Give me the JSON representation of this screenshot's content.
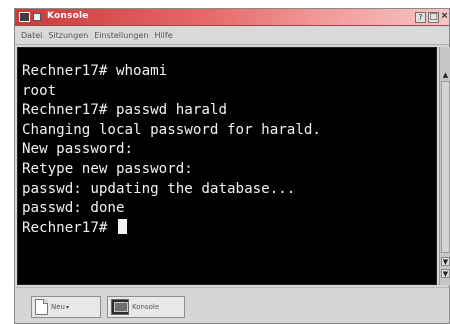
{
  "window": {
    "title": "Konsole",
    "help_label": "?",
    "minimize_label": "□",
    "close_label": "×"
  },
  "menu": {
    "items": [
      "Datei",
      "Sitzungen",
      "Einstellungen",
      "Hilfe"
    ]
  },
  "terminal": {
    "lines": [
      "Rechner17# whoami",
      "root",
      "Rechner17# passwd harald",
      "Changing local password for harald.",
      "New password:",
      "Retype new password:",
      "passwd: updating the database...",
      "passwd: done",
      "Rechner17# "
    ]
  },
  "scrollbar": {
    "up_arrow": "▲",
    "down_arrow": "▼"
  },
  "taskbar": {
    "items": [
      {
        "label": "Neu",
        "icon": "new-document-icon"
      },
      {
        "label": "Konsole",
        "icon": "terminal-icon"
      }
    ],
    "dropdown_glyph": "▾"
  },
  "colors": {
    "titlebar_start": "#c93a3a",
    "terminal_bg": "#000000",
    "terminal_fg": "#f2f2f2",
    "chrome": "#d6d6d6"
  }
}
